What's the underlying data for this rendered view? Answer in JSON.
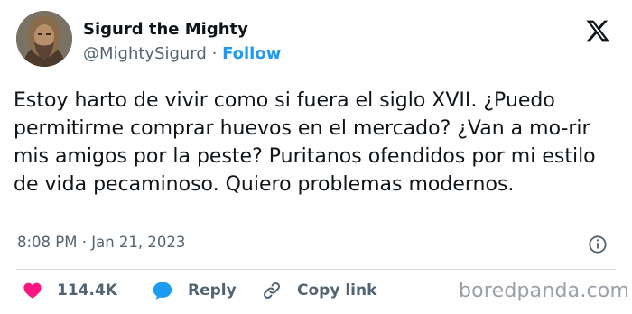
{
  "author": {
    "display_name": "Sigurd the Mighty",
    "handle": "@MightySigurd",
    "separator": "·",
    "follow_label": "Follow"
  },
  "tweet": {
    "text": "Estoy harto de vivir como si fuera el siglo XVII. ¿Puedo permitirme comprar huevos en el mercado? ¿Van a mo-rir mis amigos por la peste? Puritanos ofendidos por mi estilo de vida pecaminoso. Quiero problemas modernos.",
    "timestamp": "8:08 PM · Jan 21, 2023"
  },
  "actions": {
    "likes": "114.4K",
    "reply_label": "Reply",
    "copy_link_label": "Copy link"
  },
  "watermark": "boredpanda.com",
  "icons": {
    "brand": "x-logo-icon",
    "info": "info-icon",
    "like": "heart-icon",
    "reply": "speech-bubble-icon",
    "copy": "link-icon"
  },
  "colors": {
    "text": "#0f1419",
    "secondary": "#536471",
    "accent": "#1d9bf0",
    "like": "#f91880",
    "divider": "#cfd9de"
  }
}
